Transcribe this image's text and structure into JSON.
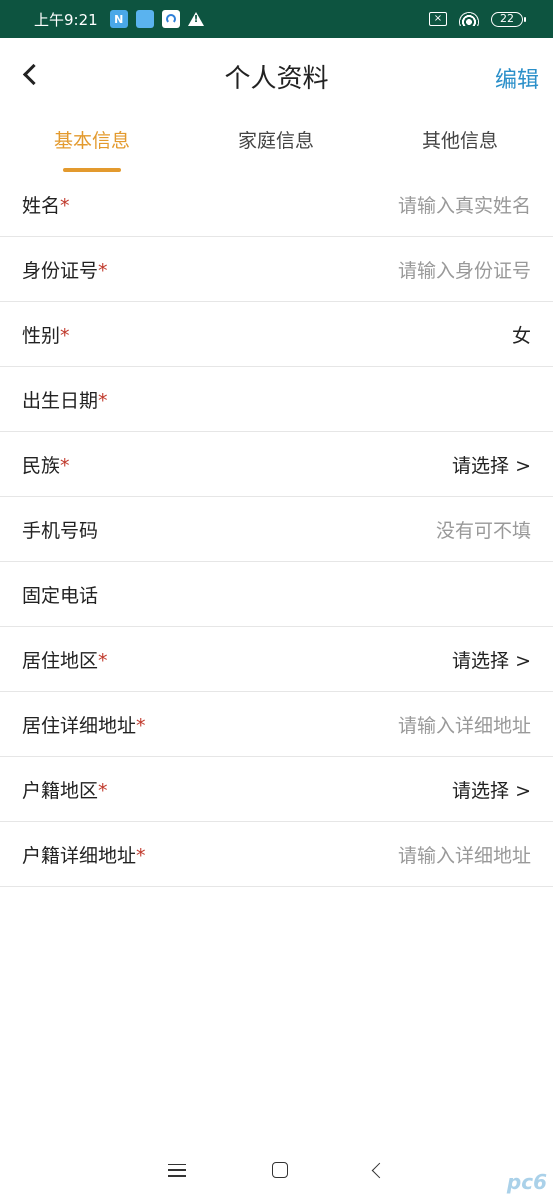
{
  "status_bar": {
    "time": "上午9:21",
    "notif_badge": "N",
    "battery": "22"
  },
  "header": {
    "title": "个人资料",
    "edit_label": "编辑"
  },
  "tabs": [
    {
      "label": "基本信息",
      "active": true
    },
    {
      "label": "家庭信息",
      "active": false
    },
    {
      "label": "其他信息",
      "active": false
    }
  ],
  "form": {
    "required_mark": "*",
    "rows": [
      {
        "label": "姓名",
        "value": "请输入真实姓名"
      },
      {
        "label": "身份证号",
        "value": "请输入身份证号"
      },
      {
        "label": "性别",
        "value": "女"
      },
      {
        "label": "出生日期",
        "value": ""
      },
      {
        "label": "民族",
        "value": "请选择 >"
      },
      {
        "label": "手机号码",
        "value": "没有可不填"
      },
      {
        "label": "固定电话",
        "value": ""
      },
      {
        "label": "居住地区",
        "value": "请选择 >"
      },
      {
        "label": "居住详细地址",
        "value": "请输入详细地址"
      },
      {
        "label": "户籍地区",
        "value": "请选择 >"
      },
      {
        "label": "户籍详细地址",
        "value": "请输入详细地址"
      }
    ]
  },
  "watermark": "pc6",
  "icons": {
    "back": "chevron-left-icon",
    "nav_menu": "menu-icon",
    "nav_home": "home-icon",
    "nav_back": "back-icon"
  },
  "colors": {
    "status_bar": "#0d5440",
    "accent_tab": "#e39a2e",
    "edit_link": "#2a8fc9",
    "required": "#c0392b",
    "placeholder": "#999999"
  }
}
